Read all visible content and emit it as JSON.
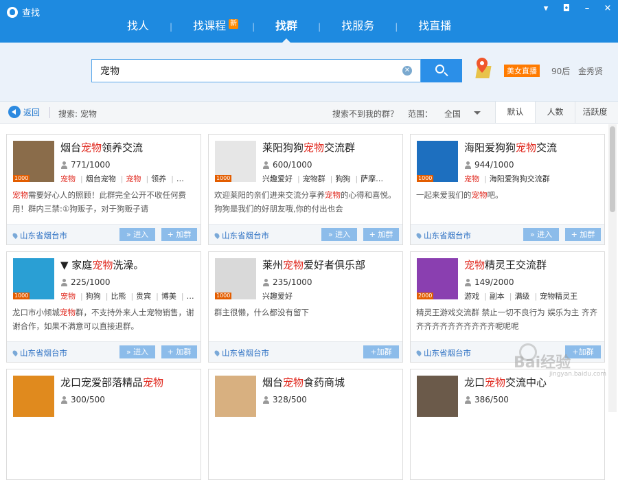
{
  "window": {
    "title": "查找",
    "controls": [
      "menu-icon",
      "skin-icon",
      "minimize-icon",
      "close-icon"
    ]
  },
  "tabs": [
    {
      "label": "找人",
      "active": false
    },
    {
      "label": "找课程",
      "active": false,
      "badge": "新"
    },
    {
      "label": "找群",
      "active": true
    },
    {
      "label": "找服务",
      "active": false
    },
    {
      "label": "找直播",
      "active": false
    }
  ],
  "search": {
    "value": "宠物",
    "placeholder": ""
  },
  "suggest": {
    "live_badge": "美女直播",
    "kw1": "90后",
    "kw2": "金秀贤"
  },
  "filter": {
    "back": "返回",
    "search_label": "搜索: 宠物",
    "not_found": "搜索不到我的群？",
    "range_label": "范围：",
    "range_value": "全国",
    "sort": [
      "默认",
      "人数",
      "活跃度"
    ]
  },
  "cards": [
    {
      "title_pre": "烟台",
      "title_hl": "宠物",
      "title_post": "领养交流",
      "count": "771/1000",
      "tags": [
        "宠物",
        "烟台宠物",
        "宠物",
        "领养",
        "…"
      ],
      "desc_pre": "",
      "desc_hl": "宠物",
      "desc_post": "需要好心人的照顾！此群完全公开不收任何费用！群内三禁:①狗贩子，对于狗贩子请",
      "location": "山东省烟台市",
      "enter": "» 进入",
      "join": "+ 加群",
      "badge": "1000",
      "img": "#8a6c4a"
    },
    {
      "title_pre": "莱阳狗狗",
      "title_hl": "宠物",
      "title_post": "交流群",
      "count": "600/1000",
      "tags": [
        "兴趣爱好",
        "宠物群",
        "狗狗",
        "萨摩…"
      ],
      "desc_pre": "欢迎莱阳的亲们进来交流分享养",
      "desc_hl": "宠物",
      "desc_post": "的心得和喜悦。狗狗是我们的好朋友哦,你的付出也会",
      "location": "山东省烟台市",
      "enter": "» 进入",
      "join": "+ 加群",
      "badge": "1000",
      "img": "#e6e6e6"
    },
    {
      "title_pre": "海阳爱狗狗",
      "title_hl": "宠物",
      "title_post": "交流",
      "count": "944/1000",
      "tags": [
        "宠物",
        "海阳爱狗狗交流群"
      ],
      "desc_pre": "一起来爱我们的",
      "desc_hl": "宠物",
      "desc_post": "吧。",
      "location": "山东省烟台市",
      "enter": "» 进入",
      "join": "+ 加群",
      "badge": "1000",
      "img": "#1d6fbf"
    },
    {
      "title_pre": "▼ 家庭",
      "title_hl": "宠物",
      "title_post": "洗澡。",
      "count": "225/1000",
      "tags": [
        "宠物",
        "狗狗",
        "比熊",
        "贵宾",
        "博美",
        "…"
      ],
      "desc_pre": "龙口市小倾城",
      "desc_hl": "宠物",
      "desc_post": "群，不支持外来人士宠物销售，谢谢合作，如果不满意可以直接退群。",
      "location": "山东省烟台市",
      "enter": "» 进入",
      "join": "+ 加群",
      "badge": "1000",
      "img": "#2a9fd4"
    },
    {
      "title_pre": "莱州",
      "title_hl": "宠物",
      "title_post": "爱好者俱乐部",
      "count": "235/1000",
      "tags": [
        "兴趣爱好"
      ],
      "desc_pre": "群主很懒，什么都没有留下",
      "desc_hl": "",
      "desc_post": "",
      "location": "山东省烟台市",
      "enter": "",
      "join": "+加群",
      "badge": "1000",
      "img": "#d9d9d9"
    },
    {
      "title_pre": "",
      "title_hl": "宠物",
      "title_post": "精灵王交流群",
      "count": "149/2000",
      "tags": [
        "游戏",
        "副本",
        "满级",
        "宠物精灵王"
      ],
      "desc_pre": "精灵王游戏交流群 禁止一切不良行为 娱乐为主 齐齐齐齐齐齐齐齐齐齐齐齐呢呢呢",
      "desc_hl": "",
      "desc_post": "",
      "location": "山东省烟台市",
      "enter": "",
      "join": "+加群",
      "badge": "2000",
      "img": "#8a3fb0"
    },
    {
      "title_pre": "龙口宠爱部落精品",
      "title_hl": "宠物",
      "title_post": "",
      "count": "300/500",
      "tags": [],
      "desc_pre": "",
      "desc_hl": "",
      "desc_post": "",
      "location": "",
      "enter": "",
      "join": "",
      "badge": "",
      "img": "#e08a1e"
    },
    {
      "title_pre": "烟台",
      "title_hl": "宠物",
      "title_post": "食药商城",
      "count": "328/500",
      "tags": [],
      "desc_pre": "",
      "desc_hl": "",
      "desc_post": "",
      "location": "",
      "enter": "",
      "join": "",
      "badge": "",
      "img": "#d8b080"
    },
    {
      "title_pre": "龙口",
      "title_hl": "宠物",
      "title_post": "交流中心",
      "count": "386/500",
      "tags": [],
      "desc_pre": "",
      "desc_hl": "",
      "desc_post": "",
      "location": "",
      "enter": "",
      "join": "",
      "badge": "",
      "img": "#6b5a4a"
    }
  ],
  "watermark": {
    "text": "Bai经验",
    "url": "jingyan.baidu.com"
  },
  "colors": {
    "titlebar": "#1e8ae0",
    "highlight": "#e0281e",
    "link": "#2f72c4",
    "button": "#8cbcea"
  }
}
